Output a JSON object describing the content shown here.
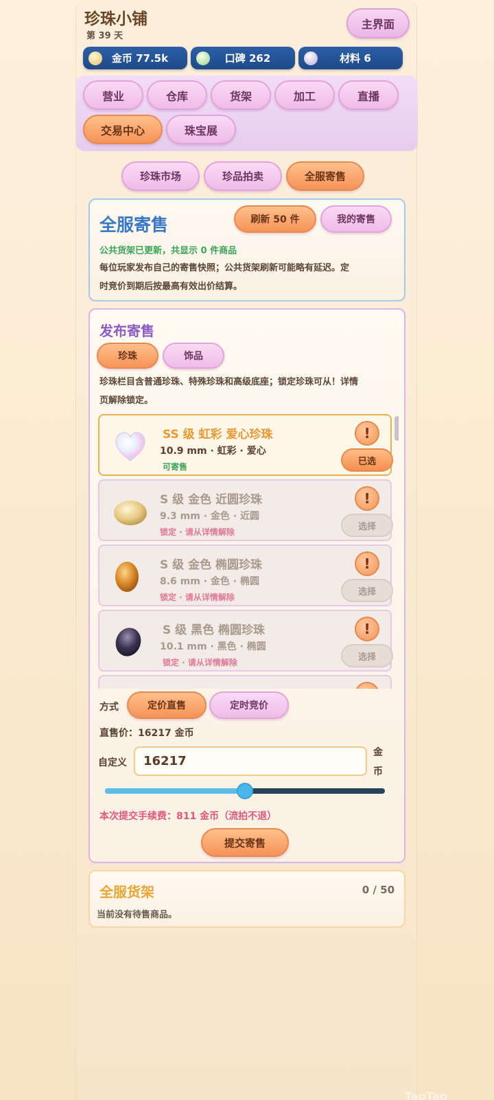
{
  "header": {
    "title": "珍珠小铺",
    "day": "第 39 天",
    "main_button": "主界面"
  },
  "stats": {
    "coins": "金币 77.5k",
    "reputation": "口碑 262",
    "materials": "材料 6"
  },
  "nav": {
    "tabs": [
      "营业",
      "仓库",
      "货架",
      "加工",
      "直播",
      "交易中心",
      "珠宝展"
    ],
    "active": "交易中心"
  },
  "subnav": {
    "tabs": [
      "珍珠市场",
      "珍品拍卖",
      "全服寄售"
    ],
    "active": "全服寄售"
  },
  "consign": {
    "title": "全服寄售",
    "refresh_button": "刷新 50 件",
    "my_button": "我的寄售",
    "status": "公共货架已更新，共显示 0 件商品",
    "desc_line1": "每位玩家发布自己的寄售快照；公共货架刷新可能略有延迟。定",
    "desc_line2": "时竞价到期后按最高有效出价结算。"
  },
  "publish": {
    "title": "发布寄售",
    "tabs": [
      "珍珠",
      "饰品"
    ],
    "active_tab": "珍珠",
    "desc_line1": "珍珠栏目含普通珍珠、特殊珍珠和高级底座；锁定珍珠可从！详情",
    "desc_line2": "页解除锁定。",
    "items": [
      {
        "name": "SS 级 虹彩 爱心珍珠",
        "spec": "10.9 mm · 虹彩 · 爱心",
        "status": "可寄售",
        "button": "已选",
        "selected": true
      },
      {
        "name": "S 级 金色 近圆珍珠",
        "spec": "9.3 mm · 金色 · 近圆",
        "status": "锁定 · 请从详情解除",
        "button": "选择",
        "selected": false
      },
      {
        "name": "S 级 金色 椭圆珍珠",
        "spec": "8.6 mm · 金色 · 椭圆",
        "status": "锁定 · 请从详情解除",
        "button": "选择",
        "selected": false
      },
      {
        "name": "S 级 黑色 椭圆珍珠",
        "spec": "10.1 mm · 黑色 · 椭圆",
        "status": "锁定 · 请从详情解除",
        "button": "选择",
        "selected": false
      }
    ],
    "warn_symbol": "!",
    "mode_label": "方式",
    "mode_fixed": "定价直售",
    "mode_auction": "定时竞价",
    "price_line": "直售价：16217 金币",
    "custom_label": "自定义",
    "custom_value": "16217",
    "unit_line1": "金",
    "unit_line2": "币",
    "slider_fraction": 0.5,
    "fee_line": "本次提交手续费：811 金币（流拍不退）",
    "submit_button": "提交寄售"
  },
  "market": {
    "title": "全服货架",
    "count": "0 / 50",
    "empty": "当前没有待售商品。"
  },
  "watermark": "TapTap"
}
